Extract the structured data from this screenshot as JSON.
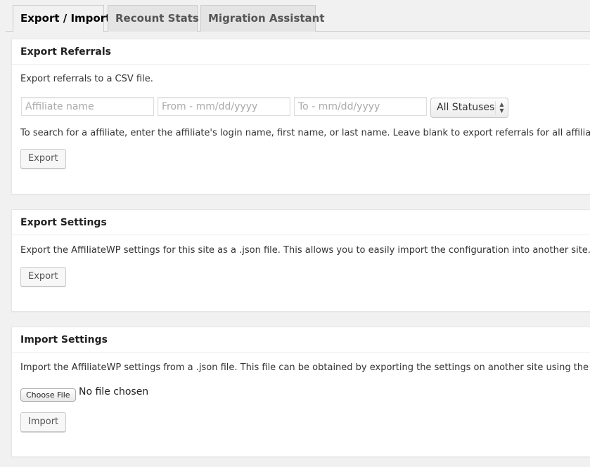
{
  "tabs": [
    {
      "label": "Export / Import",
      "active": true
    },
    {
      "label": "Recount Stats",
      "active": false
    },
    {
      "label": "Migration Assistant",
      "active": false
    }
  ],
  "export_referrals": {
    "title": "Export Referrals",
    "description": "Export referrals to a CSV file.",
    "affiliate_placeholder": "Affiliate name",
    "from_placeholder": "From - mm/dd/yyyy",
    "to_placeholder": "To - mm/dd/yyyy",
    "status_selected": "All Statuses",
    "help_text": "To search for a affiliate, enter the affiliate's login name, first name, or last name. Leave blank to export referrals for all affiliates.",
    "button_label": "Export"
  },
  "export_settings": {
    "title": "Export Settings",
    "description": "Export the AffiliateWP settings for this site as a .json file. This allows you to easily import the configuration into another site.",
    "button_label": "Export"
  },
  "import_settings": {
    "title": "Import Settings",
    "description": "Import the AffiliateWP settings from a .json file. This file can be obtained by exporting the settings on another site using the form above.",
    "choose_file_label": "Choose File",
    "file_status": "No file chosen",
    "button_label": "Import"
  }
}
